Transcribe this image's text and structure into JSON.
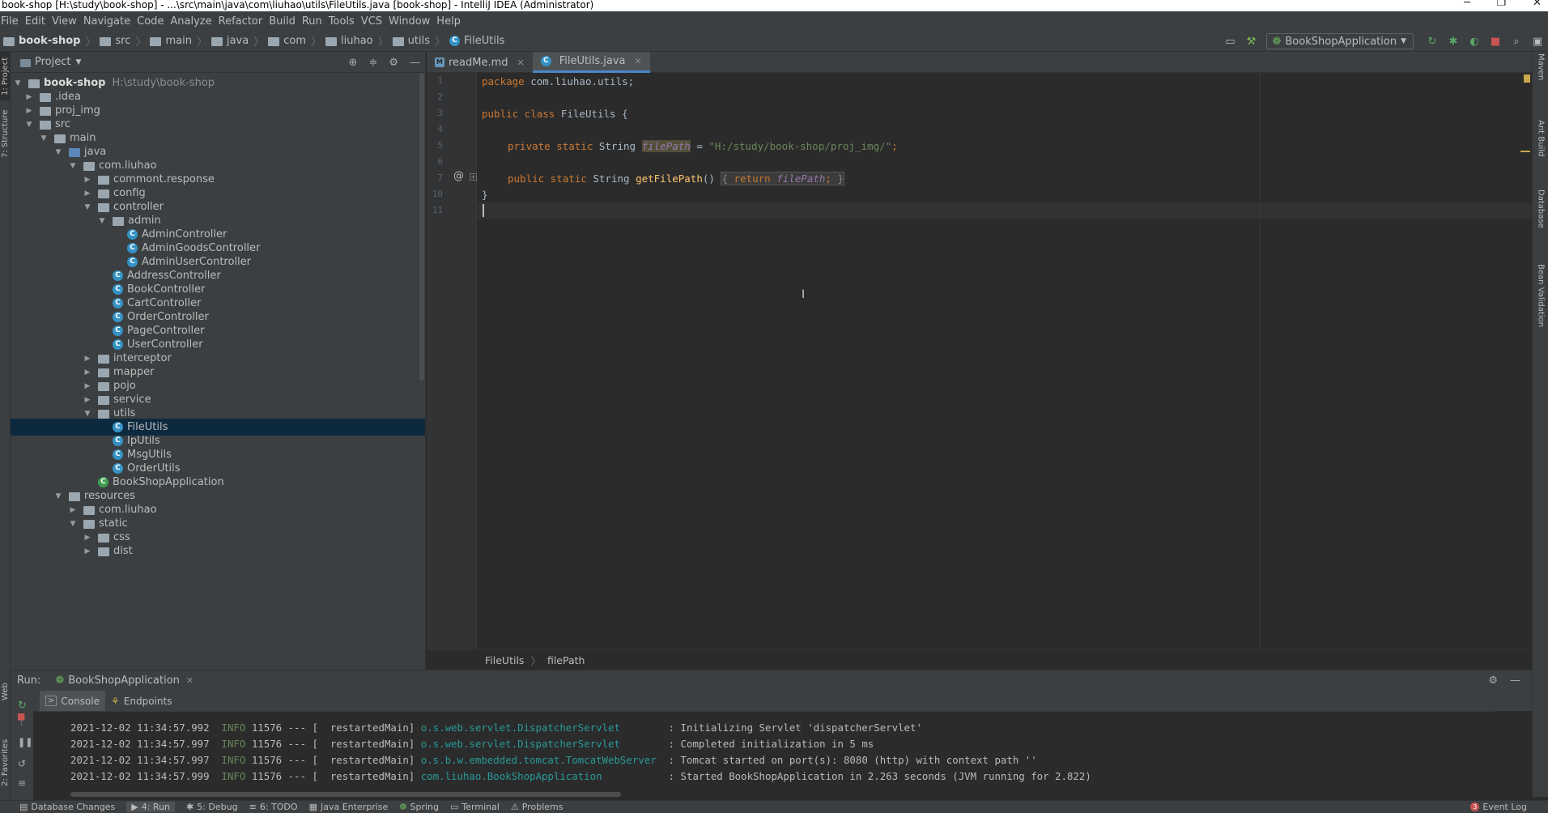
{
  "window": {
    "title": "book-shop [H:\\study\\book-shop] - ...\\src\\main\\java\\com\\liuhao\\utils\\FileUtils.java [book-shop] - IntelliJ IDEA (Administrator)"
  },
  "menu": [
    "File",
    "Edit",
    "View",
    "Navigate",
    "Code",
    "Analyze",
    "Refactor",
    "Build",
    "Run",
    "Tools",
    "VCS",
    "Window",
    "Help"
  ],
  "nav": {
    "crumbs": [
      "book-shop",
      "src",
      "main",
      "java",
      "com",
      "liuhao",
      "utils",
      "FileUtils"
    ],
    "run_config": "BookShopApplication"
  },
  "project_panel": {
    "title": "Project",
    "root_name": "book-shop",
    "root_path": "H:\\study\\book-shop",
    "items": [
      ".idea",
      "proj_img",
      "src",
      "main",
      "java",
      "com.liuhao",
      "commont.response",
      "config",
      "controller",
      "admin",
      "AdminController",
      "AdminGoodsController",
      "AdminUserController",
      "AddressController",
      "BookController",
      "CartController",
      "OrderController",
      "PageController",
      "UserController",
      "interceptor",
      "mapper",
      "pojo",
      "service",
      "utils",
      "FileUtils",
      "IpUtils",
      "MsgUtils",
      "OrderUtils",
      "BookShopApplication",
      "resources",
      "com.liuhao",
      "static",
      "css",
      "dist"
    ]
  },
  "left_stripe": {
    "project": "1: Project",
    "structure": "7: Structure",
    "web": "Web",
    "favorites": "2: Favorites"
  },
  "right_stripe": {
    "maven": "Maven",
    "ant": "Ant Build",
    "database": "Database",
    "bean": "Bean Validation"
  },
  "editor": {
    "tabs": [
      "readMe.md",
      "FileUtils.java"
    ],
    "line_numbers": [
      "1",
      "2",
      "3",
      "4",
      "5",
      "6",
      "7",
      "10",
      "11"
    ],
    "lines": {
      "l1_kw": "package",
      "l1_rest": " com.liuhao.utils;",
      "l3_kw": "public class",
      "l3_rest": " FileUtils {",
      "l5_kw": "private static",
      "l5_type": " String ",
      "l5_field": "filePath",
      "l5_eq": " = ",
      "l5_str": "\"H:/study/book-shop/proj_img/\"",
      "l5_end": ";",
      "l7_kw": "public static",
      "l7_type": " String ",
      "l7_fn": "getFilePath",
      "l7_paren": "() ",
      "l7_fold_open": "{ ",
      "l7_ret": "return ",
      "l7_field": "filePath",
      "l7_semi": "; ",
      "l7_fold_close": "}",
      "l10": "}"
    },
    "breadcrumb": [
      "FileUtils",
      "filePath"
    ]
  },
  "run": {
    "label": "Run:",
    "config": "BookShopApplication",
    "subtabs": [
      "Console",
      "Endpoints"
    ],
    "logs": [
      {
        "ts": "2021-12-02 11:34:57.992",
        "level": "INFO",
        "pid": "11576",
        "sep": "---",
        "thread": "[  restartedMain]",
        "logger": "o.s.web.servlet.DispatcherServlet       ",
        "msg": ": Initializing Servlet 'dispatcherServlet'"
      },
      {
        "ts": "2021-12-02 11:34:57.997",
        "level": "INFO",
        "pid": "11576",
        "sep": "---",
        "thread": "[  restartedMain]",
        "logger": "o.s.web.servlet.DispatcherServlet       ",
        "msg": ": Completed initialization in 5 ms"
      },
      {
        "ts": "2021-12-02 11:34:57.997",
        "level": "INFO",
        "pid": "11576",
        "sep": "---",
        "thread": "[  restartedMain]",
        "logger": "o.s.b.w.embedded.tomcat.TomcatWebServer ",
        "msg": ": Tomcat started on port(s): 8080 (http) with context path ''"
      },
      {
        "ts": "2021-12-02 11:34:57.999",
        "level": "INFO",
        "pid": "11576",
        "sep": "---",
        "thread": "[  restartedMain]",
        "logger": "com.liuhao.BookShopApplication          ",
        "msg": ": Started BookShopApplication in 2.263 seconds (JVM running for 2.822)"
      }
    ]
  },
  "statusbar": {
    "tabs": [
      "Database Changes",
      "4: Run",
      "5: Debug",
      "6: TODO",
      "Java Enterprise",
      "Spring",
      "Terminal",
      "Problems"
    ],
    "event_log": "Event Log",
    "event_count": "3"
  }
}
